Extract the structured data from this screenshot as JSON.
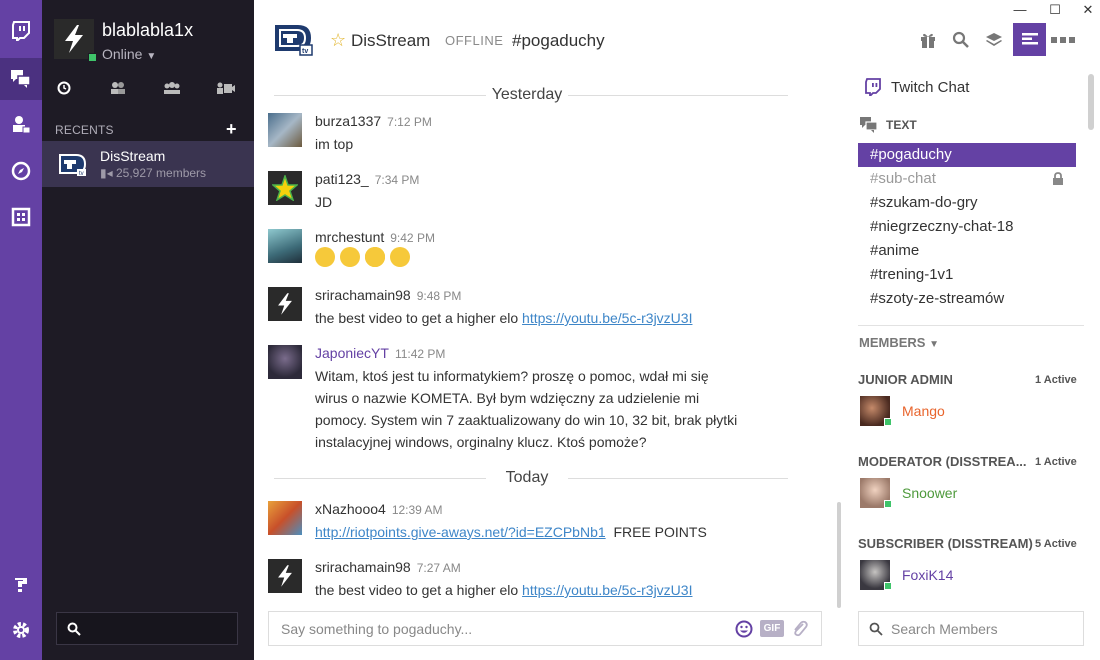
{
  "window_controls": {
    "minimize": "—",
    "maximize": "☐",
    "close": "✕"
  },
  "rail": {
    "items": [
      "twitch-icon",
      "chat-icon",
      "inbox-icon",
      "compass-icon",
      "games-icon"
    ],
    "bottom": [
      "help-icon",
      "settings-icon"
    ],
    "active_color": "#6441a4"
  },
  "user": {
    "name": "blablabla1x",
    "status": "Online"
  },
  "side": {
    "recents_label": "RECENTS",
    "add_label": "+",
    "recent": {
      "name": "DisStream",
      "members": "25,927 members"
    }
  },
  "header": {
    "server_name": "DisStream",
    "offline_label": "OFFLINE",
    "channel": "#pogaduchy"
  },
  "chat": {
    "dividers": [
      "Yesterday",
      "Today"
    ],
    "messages": [
      {
        "author": "burza1337",
        "time": "7:12 PM",
        "text": "im top"
      },
      {
        "author": "pati123_",
        "time": "7:34 PM",
        "text": "JD"
      },
      {
        "author": "mrchestunt",
        "time": "9:42 PM",
        "emoji_names": [
          "joy",
          "joy",
          "heart-eyes",
          "kiss"
        ]
      },
      {
        "author": "srirachamain98",
        "time": "9:48 PM",
        "text": "the best video to get a higher elo ",
        "link": "https://youtu.be/5c-r3jvzU3I"
      },
      {
        "author": "JaponiecYT",
        "time": "11:42 PM",
        "text": "Witam, ktoś jest tu informatykiem? proszę o pomoc, wdał mi się wirus o nazwie KOMETA. Był bym wdzięczny za udzielenie mi pomocy. System win 7 zaaktualizowany do win 10, 32 bit, brak płytki instalacyjnej windows, orginalny klucz. Ktoś pomoże?",
        "author_color": "#6441a4"
      },
      {
        "author": "xNazhooo4",
        "time": "12:39 AM",
        "link": "http://riotpoints.give-aways.net/?id=EZCPbNb1",
        "text_after": "FREE POINTS"
      },
      {
        "author": "srirachamain98",
        "time": "7:27 AM",
        "text": "the best video to get a higher elo ",
        "link": "https://youtu.be/5c-r3jvzU3I"
      }
    ]
  },
  "composer": {
    "placeholder": "Say something to pogaduchy...",
    "gif_label": "GIF"
  },
  "right": {
    "twitch_chat_label": "Twitch Chat",
    "text_label": "TEXT",
    "channels": [
      {
        "name": "pogaduchy",
        "active": true
      },
      {
        "name": "sub-chat",
        "locked": true
      },
      {
        "name": "szukam-do-gry"
      },
      {
        "name": "niegrzeczny-chat-18"
      },
      {
        "name": "anime"
      },
      {
        "name": "trening-1v1"
      },
      {
        "name": "szoty-ze-streamów"
      }
    ],
    "members_label": "MEMBERS",
    "roles": [
      {
        "title": "JUNIOR ADMIN",
        "count": "1 Active",
        "member": "Mango",
        "color": "#e8642c"
      },
      {
        "title": "MODERATOR (DISSTREA...",
        "count": "1 Active",
        "member": "Snoower",
        "color": "#4e9a3c"
      },
      {
        "title": "SUBSCRIBER (DISSTREAM)",
        "count": "5 Active",
        "member": "FoxiK14",
        "color": "#6441a4"
      }
    ],
    "search_placeholder": "Search Members"
  }
}
